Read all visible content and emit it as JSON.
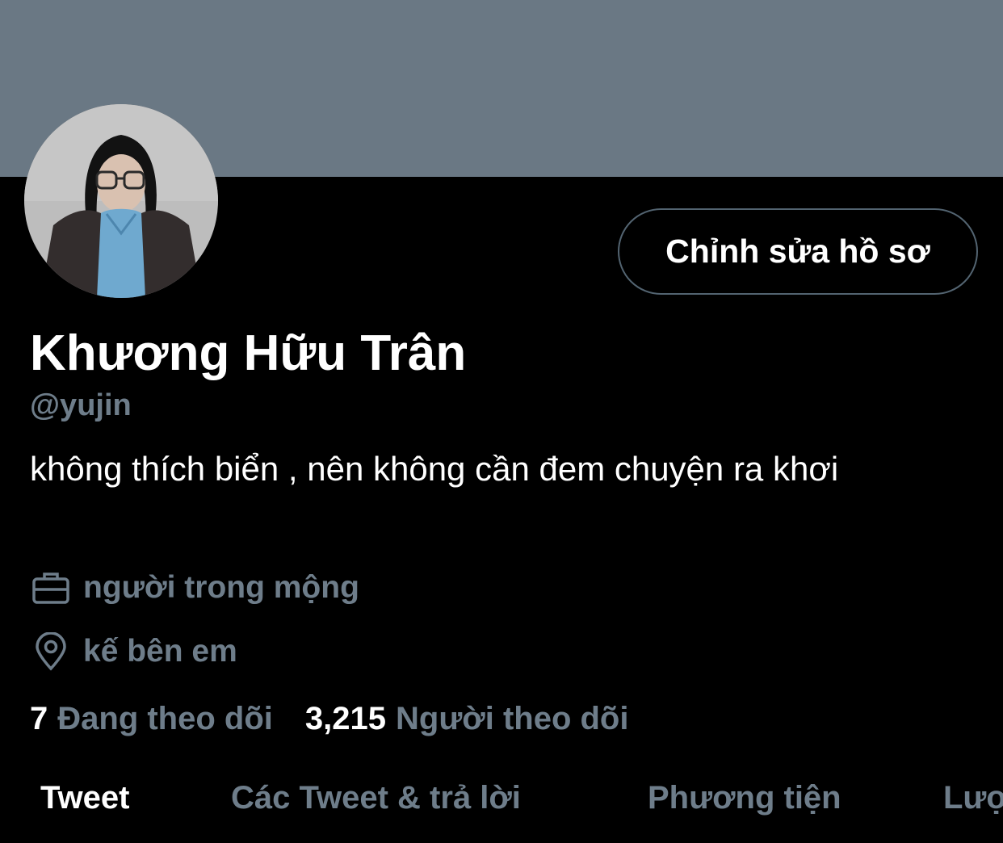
{
  "profile": {
    "display_name": "Khương Hữu Trân",
    "handle": "@yujin",
    "bio": "không thích biển , nên không cần đem chuyện ra khơi",
    "edit_button_label": "Chỉnh sửa hồ sơ",
    "work": "người trong mộng",
    "location": "kế bên em",
    "following_count": "7",
    "following_label": "Đang theo dõi",
    "followers_count": "3,215",
    "followers_label": "Người theo dõi"
  },
  "tabs": [
    {
      "label": "Tweet",
      "active": true
    },
    {
      "label": "Các Tweet & trả lời",
      "active": false
    },
    {
      "label": "Phương tiện",
      "active": false
    },
    {
      "label": "Lượt thích",
      "active": false
    }
  ],
  "icons": {
    "work": "briefcase-icon",
    "location": "location-pin-icon"
  },
  "colors": {
    "banner": "#6a7884",
    "background": "#000000",
    "muted_text": "#6e7d8a",
    "button_border": "#536471"
  }
}
